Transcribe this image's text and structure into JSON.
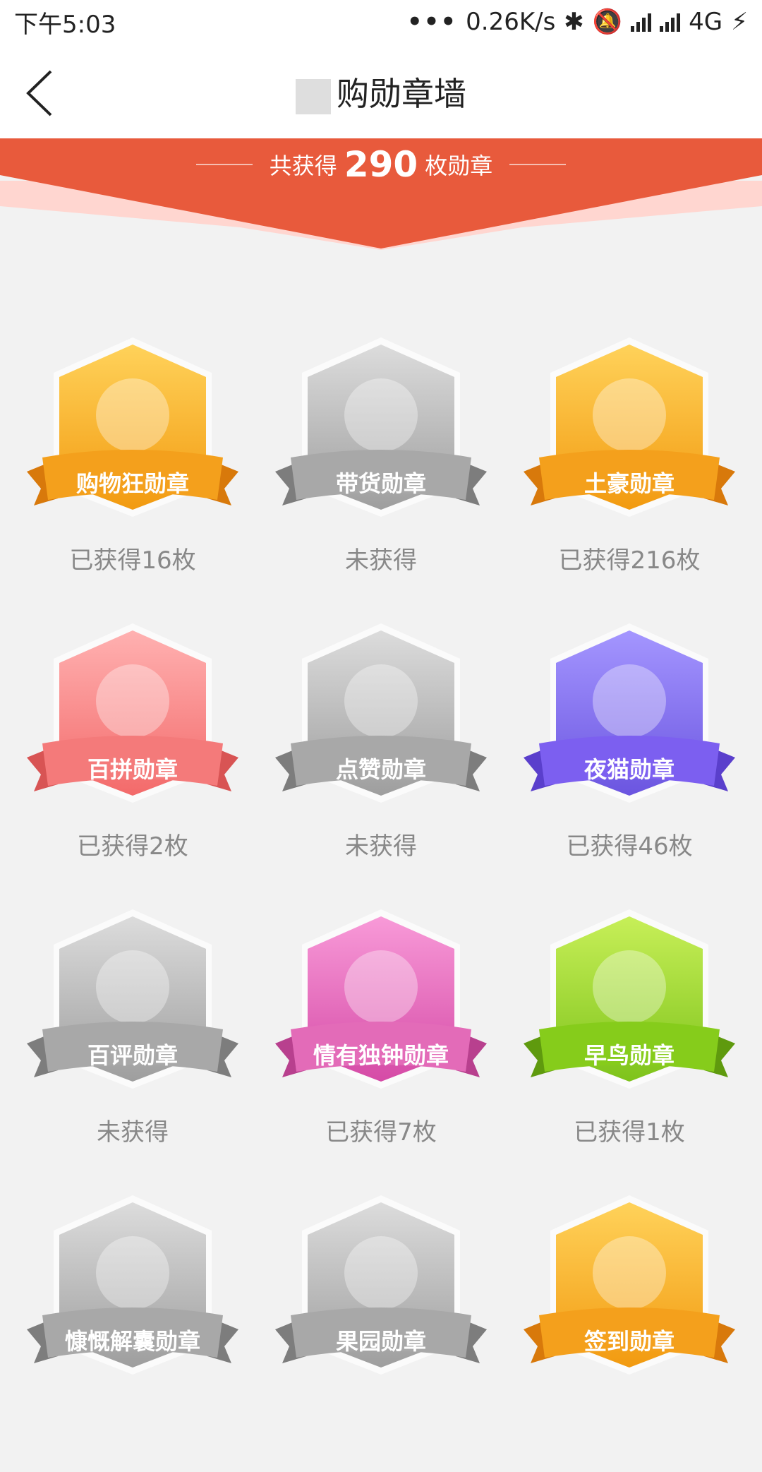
{
  "statusbar": {
    "time": "下午5:03",
    "network": "0.26K/s",
    "carrier": "4G"
  },
  "header": {
    "title": "购勋章墙"
  },
  "banner": {
    "prefix": "共获得",
    "count": "290",
    "suffix": "枚勋章"
  },
  "colors": {
    "accent": "#e85a3c",
    "gold": "#f4a01c",
    "gray": "#9e9e9e"
  },
  "badges": [
    {
      "label": "购物狂勋章",
      "status": "已获得16枚",
      "theme": "gold",
      "icon": "wine-basket-icon"
    },
    {
      "label": "带货勋章",
      "status": "未获得",
      "theme": "gray",
      "icon": "box-carrier-icon"
    },
    {
      "label": "土豪勋章",
      "status": "已获得216枚",
      "theme": "gold",
      "icon": "rich-man-icon"
    },
    {
      "label": "百拼勋章",
      "status": "已获得2枚",
      "theme": "pink",
      "icon": "hundred-box-icon"
    },
    {
      "label": "点赞勋章",
      "status": "未获得",
      "theme": "gray",
      "icon": "thumbs-up-icon"
    },
    {
      "label": "夜猫勋章",
      "status": "已获得46枚",
      "theme": "purple",
      "icon": "owl-icon"
    },
    {
      "label": "百评勋章",
      "status": "未获得",
      "theme": "gray",
      "icon": "review-card-icon"
    },
    {
      "label": "情有独钟勋章",
      "status": "已获得7枚",
      "theme": "magenta",
      "icon": "heart-box-icon"
    },
    {
      "label": "早鸟勋章",
      "status": "已获得1枚",
      "theme": "green",
      "icon": "cuckoo-clock-icon"
    },
    {
      "label": "慷慨解囊勋章",
      "status": "",
      "theme": "gray",
      "icon": "money-bag-icon"
    },
    {
      "label": "果园勋章",
      "status": "",
      "theme": "gray",
      "icon": "orchard-tree-icon"
    },
    {
      "label": "签到勋章",
      "status": "",
      "theme": "gold",
      "icon": "calendar-icon"
    }
  ]
}
